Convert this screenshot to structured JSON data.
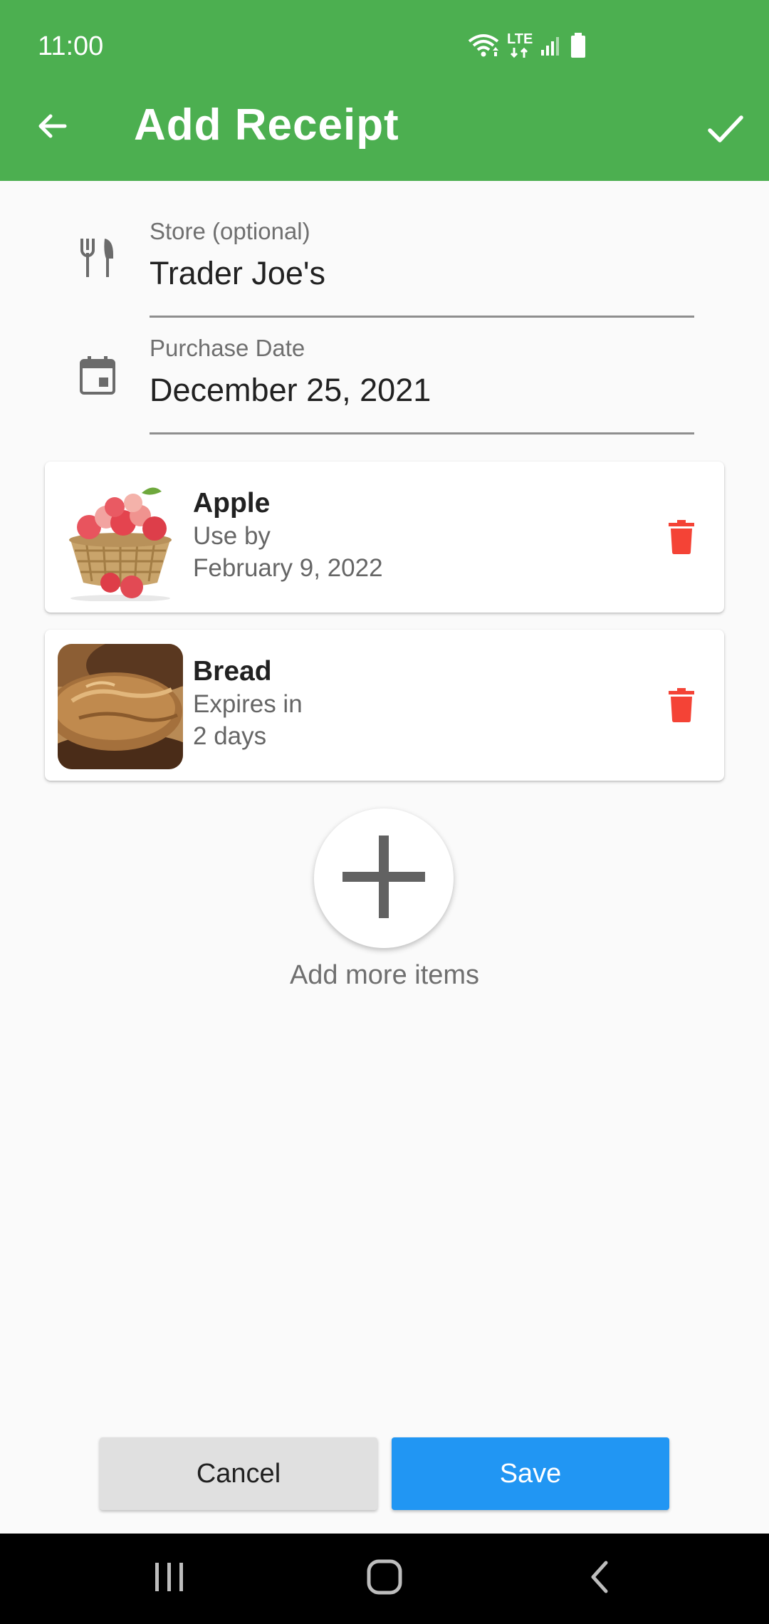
{
  "status_bar": {
    "time": "11:00",
    "network_label": "LTE",
    "icons": [
      "wifi-icon",
      "lte-icon",
      "signal-icon",
      "battery-icon"
    ]
  },
  "app_bar": {
    "title": "Add Receipt",
    "back_icon": "arrow-back-icon",
    "confirm_icon": "check-icon"
  },
  "form": {
    "store": {
      "label": "Store (optional)",
      "value": "Trader Joe's",
      "icon": "restaurant-icon"
    },
    "purchase_date": {
      "label": "Purchase Date",
      "value": "December 25, 2021",
      "icon": "calendar-icon"
    }
  },
  "items": [
    {
      "name": "Apple",
      "line1": "Use by",
      "line2": "February 9, 2022",
      "image": "apple-basket-image",
      "action_icon": "trash-icon"
    },
    {
      "name": "Bread",
      "line1": "Expires in",
      "line2": "2 days",
      "image": "bread-image",
      "action_icon": "trash-icon"
    }
  ],
  "add_more": {
    "label": "Add more items",
    "icon": "plus-icon"
  },
  "actions": {
    "cancel_label": "Cancel",
    "save_label": "Save"
  },
  "colors": {
    "primary": "#4caf50",
    "save": "#2196f3",
    "cancel": "#e0e0e0",
    "delete": "#f44336",
    "background": "#fafafa"
  },
  "nav_bar": {
    "icons": [
      "recents-icon",
      "home-icon",
      "back-nav-icon"
    ]
  }
}
